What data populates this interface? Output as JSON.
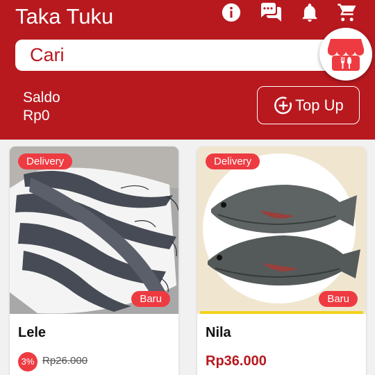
{
  "app": {
    "title": "Taka Tuku"
  },
  "icons": {
    "info": "info-icon",
    "chat": "chat-icon",
    "notification": "bell-icon",
    "cart": "cart-icon",
    "store": "store-icon",
    "topup": "add-circle-icon"
  },
  "search": {
    "placeholder": "Cari"
  },
  "balance": {
    "label": "Saldo",
    "value": "Rp0"
  },
  "topup": {
    "label": "Top Up"
  },
  "products": [
    {
      "name": "Lele",
      "badge_delivery": "Delivery",
      "badge_new": "Baru",
      "discount": "3%",
      "old_price": "Rp26.000"
    },
    {
      "name": "Nila",
      "badge_delivery": "Delivery",
      "badge_new": "Baru",
      "price": "Rp36.000"
    }
  ],
  "colors": {
    "primary": "#b8191f",
    "accent": "#ee3b42",
    "highlight": "#f2d21b"
  }
}
